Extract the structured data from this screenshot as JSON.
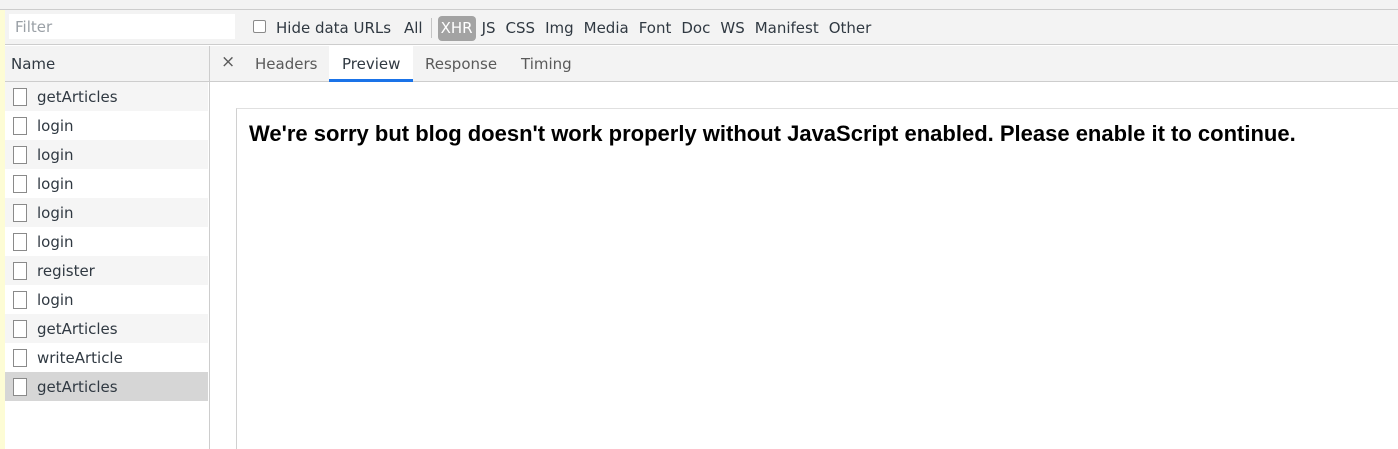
{
  "filter": {
    "placeholder": "Filter"
  },
  "hide_data_urls": {
    "label": "Hide data URLs",
    "checked": false
  },
  "type_filters": [
    {
      "label": "All",
      "active": false
    },
    {
      "label": "XHR",
      "active": true
    },
    {
      "label": "JS",
      "active": false
    },
    {
      "label": "CSS",
      "active": false
    },
    {
      "label": "Img",
      "active": false
    },
    {
      "label": "Media",
      "active": false
    },
    {
      "label": "Font",
      "active": false
    },
    {
      "label": "Doc",
      "active": false
    },
    {
      "label": "WS",
      "active": false
    },
    {
      "label": "Manifest",
      "active": false
    },
    {
      "label": "Other",
      "active": false
    }
  ],
  "requests": {
    "header": "Name",
    "rows": [
      {
        "name": "getArticles"
      },
      {
        "name": "login"
      },
      {
        "name": "login"
      },
      {
        "name": "login"
      },
      {
        "name": "login"
      },
      {
        "name": "login"
      },
      {
        "name": "register"
      },
      {
        "name": "login"
      },
      {
        "name": "getArticles"
      },
      {
        "name": "writeArticle"
      },
      {
        "name": "getArticles",
        "selected": true
      }
    ]
  },
  "detail": {
    "close_symbol": "×",
    "tabs": [
      {
        "label": "Headers",
        "active": false
      },
      {
        "label": "Preview",
        "active": true
      },
      {
        "label": "Response",
        "active": false
      },
      {
        "label": "Timing",
        "active": false
      }
    ],
    "preview_message": "We're sorry but blog doesn't work properly without JavaScript enabled. Please enable it to continue."
  },
  "colors": {
    "active_tab_underline": "#1a73e8",
    "active_filter_bg": "#a3a3a3",
    "selected_row_bg": "#d6d6d6"
  }
}
